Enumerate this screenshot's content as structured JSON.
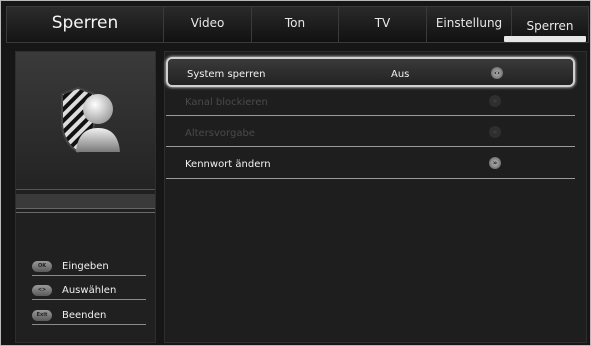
{
  "header": {
    "title": "Sperren",
    "tabs": [
      {
        "label": "Video"
      },
      {
        "label": "Ton"
      },
      {
        "label": "TV"
      },
      {
        "label": "Einstellung"
      },
      {
        "label": "Sperren"
      }
    ],
    "active_tab": "Sperren"
  },
  "side": {
    "legend": [
      {
        "key": "OK",
        "label": "Eingeben",
        "icon": "ok-key-icon"
      },
      {
        "key": "<>",
        "label": "Auswählen",
        "icon": "navigation-key-icon"
      },
      {
        "key": "Exit",
        "label": "Beenden",
        "icon": "exit-key-icon"
      }
    ]
  },
  "menu": {
    "rows": [
      {
        "label": "System sperren",
        "value": "Aus",
        "state": "selected",
        "icon": "toggle-icon"
      },
      {
        "label": "Kanal blockieren",
        "value": "",
        "state": "disabled",
        "icon": "chevron-right-icon"
      },
      {
        "label": "Altersvorgabe",
        "value": "",
        "state": "disabled",
        "icon": "chevron-right-icon"
      },
      {
        "label": "Kennwort ändern",
        "value": "",
        "state": "normal",
        "icon": "chevron-right-icon"
      }
    ]
  },
  "colors": {
    "background": "#121212",
    "panel": "#1e1e1e",
    "text": "#f2f2f2",
    "disabled_text": "#4a4a4a",
    "highlight": "#e6e6e6"
  }
}
